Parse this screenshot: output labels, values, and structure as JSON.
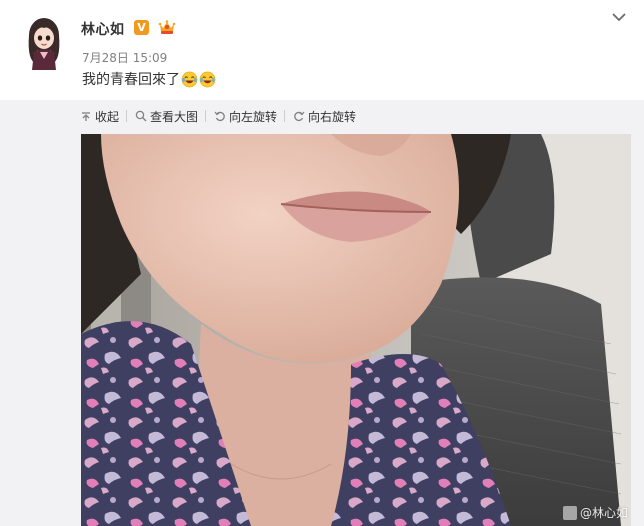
{
  "post": {
    "author": "林心如",
    "verified_mark": "V",
    "time": "7月28日 15:09",
    "text": "我的青春回來了",
    "emoji_names": [
      "laugh-tears-emoji",
      "laugh-tears-emoji"
    ]
  },
  "media_toolbar": {
    "collapse_label": "收起",
    "view_large_label": "查看大图",
    "rotate_left_label": "向左旋转",
    "rotate_right_label": "向右旋转"
  },
  "photo": {
    "watermark": "@林心如"
  },
  "colors": {
    "verified_badge": "#f09a1f",
    "media_background": "#f2f2f5",
    "text": "#333333",
    "muted": "#808080"
  }
}
